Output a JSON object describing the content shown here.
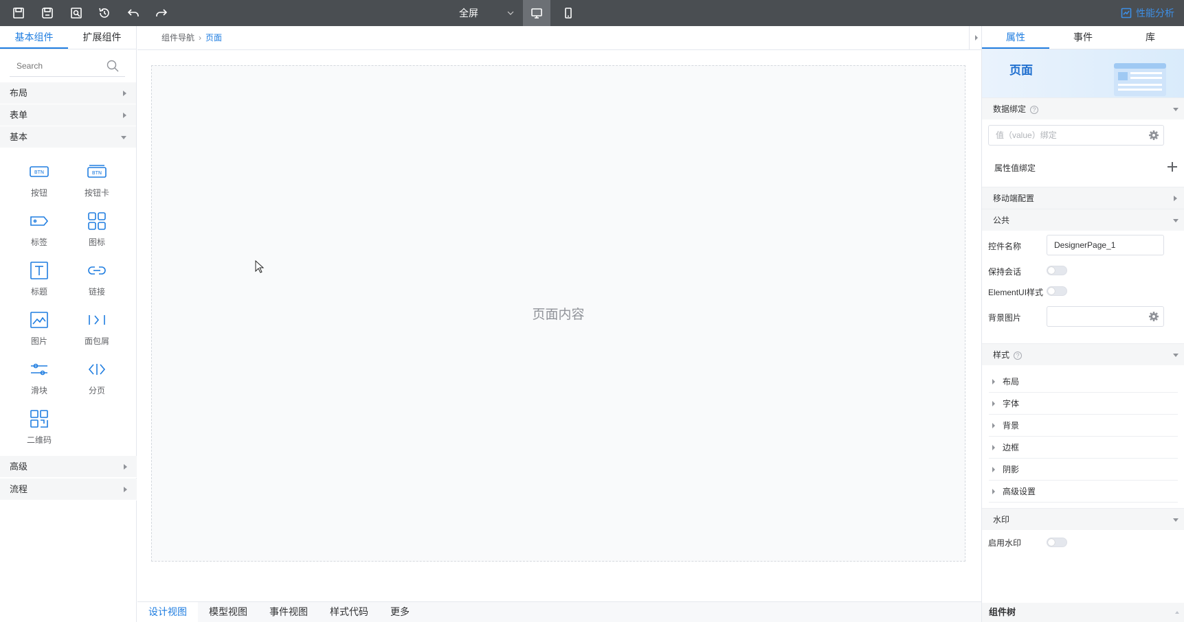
{
  "toolbar": {
    "icons": [
      "save-icon",
      "save-as-icon",
      "preview-icon",
      "history-icon",
      "undo-icon",
      "redo-icon"
    ],
    "fullscreen_label": "全屏",
    "devices": [
      "desktop-icon",
      "mobile-icon"
    ],
    "perf_label": "性能分析"
  },
  "left": {
    "tabs": [
      {
        "label": "基本组件",
        "active": true
      },
      {
        "label": "扩展组件",
        "active": false
      }
    ],
    "search_placeholder": "Search",
    "categories_top": [
      "布局",
      "表单",
      "基本"
    ],
    "components": [
      {
        "label": "按钮",
        "icon": "button-icon"
      },
      {
        "label": "按钮卡",
        "icon": "button-card-icon"
      },
      {
        "label": "标签",
        "icon": "tag-icon"
      },
      {
        "label": "图标",
        "icon": "icon-grid-icon"
      },
      {
        "label": "标题",
        "icon": "title-icon"
      },
      {
        "label": "链接",
        "icon": "link-icon"
      },
      {
        "label": "图片",
        "icon": "image-icon"
      },
      {
        "label": "面包屑",
        "icon": "breadcrumb-icon"
      },
      {
        "label": "滑块",
        "icon": "slider-icon"
      },
      {
        "label": "分页",
        "icon": "pagination-icon"
      },
      {
        "label": "二维码",
        "icon": "qrcode-icon"
      }
    ],
    "categories_bottom": [
      "高级",
      "流程"
    ]
  },
  "center": {
    "breadcrumb": {
      "root": "组件导航",
      "current": "页面"
    },
    "placeholder": "页面内容",
    "bottom_tabs": [
      {
        "label": "设计视图",
        "active": true
      },
      {
        "label": "模型视图",
        "active": false
      },
      {
        "label": "事件视图",
        "active": false
      },
      {
        "label": "样式代码",
        "active": false
      },
      {
        "label": "更多",
        "active": false
      }
    ]
  },
  "right": {
    "tabs": [
      {
        "label": "属性",
        "active": true
      },
      {
        "label": "事件",
        "active": false
      },
      {
        "label": "库",
        "active": false
      }
    ],
    "banner_title": "页面",
    "data_binding": {
      "title": "数据绑定",
      "help": "?",
      "value_placeholder": "值（value）绑定",
      "attr_binding": "属性值绑定"
    },
    "mobile_config": "移动端配置",
    "common": {
      "title": "公共",
      "name_label": "控件名称",
      "name_value": "DesignerPage_1",
      "keep_session": "保持会话",
      "element_ui": "ElementUI样式",
      "bg_image": "背景图片"
    },
    "style": {
      "title": "样式",
      "help": "?",
      "items": [
        "布局",
        "字体",
        "背景",
        "边框",
        "阴影",
        "高级设置"
      ]
    },
    "watermark": {
      "title": "水印",
      "enable_label": "启用水印"
    },
    "tree_title": "组件树"
  },
  "colors": {
    "accent": "#1f7de0",
    "topbar": "#4a4e52"
  }
}
